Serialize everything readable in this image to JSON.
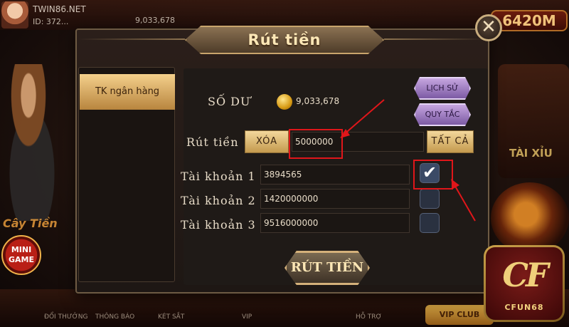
{
  "background": {
    "username": "TWIN86.NET",
    "user_id": "ID: 372...",
    "coin_display": "9,033,678",
    "jackpot": "6420M",
    "cau_tien": "Cây Tiền",
    "minigame": "MINI GAME",
    "tai_xiu": "TÀI XỈU",
    "bottom_items": [
      "ĐỔI THƯỞNG",
      "THÔNG BÁO",
      "KÉT SẮT",
      "VIP",
      "HỖ TRỢ"
    ],
    "vip_club": "VIP CLUB"
  },
  "dialog": {
    "title": "Rút tiền",
    "close_symbol": "✕",
    "sidebar": {
      "tab_label": "TK ngân hàng"
    },
    "balance": {
      "label": "SỐ DƯ",
      "value": "9,033,678"
    },
    "history_button": "LỊCH SỬ",
    "rules_button": "QUY TẮC",
    "withdraw_row": {
      "label": "Rút tiền",
      "clear_button": "XÓA",
      "amount_value": "5000000",
      "all_button": "TẤT CẢ"
    },
    "accounts": [
      {
        "label": "Tài khoản 1",
        "number": "3894565",
        "checked": true
      },
      {
        "label": "Tài khoản 2",
        "number": "1420000000",
        "checked": false
      },
      {
        "label": "Tài khoản 3",
        "number": "9516000000",
        "checked": false
      }
    ],
    "submit_button": "RÚT TIỀN"
  },
  "logo": {
    "mark": "CF",
    "text": "CFUN68"
  },
  "colors": {
    "highlight": "#e0161a",
    "gold": "#f3d79c",
    "purple_button": "#c6a6e0"
  }
}
